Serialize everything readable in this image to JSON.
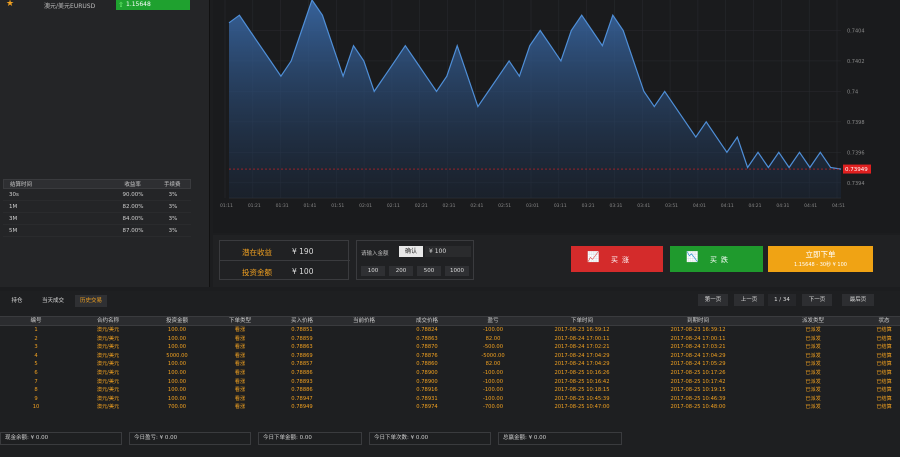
{
  "asset": {
    "name": "澳元/美元EURUSD",
    "price": "1.15648",
    "star_icon": "star-icon"
  },
  "periods": {
    "headers": [
      "结算时间",
      "收益率",
      "手续费"
    ],
    "rows": [
      [
        "30s",
        "90.00%",
        "3%"
      ],
      [
        "1M",
        "82.00%",
        "3%"
      ],
      [
        "3M",
        "84.00%",
        "3%"
      ],
      [
        "5M",
        "87.00%",
        "3%"
      ]
    ]
  },
  "chart_data": {
    "type": "area",
    "series": [
      {
        "values": [
          0.74045,
          0.7405,
          0.7404,
          0.7403,
          0.7402,
          0.7401,
          0.7402,
          0.7404,
          0.7406,
          0.7405,
          0.7403,
          0.7401,
          0.7403,
          0.7402,
          0.74,
          0.7401,
          0.7402,
          0.7403,
          0.7402,
          0.7401,
          0.74,
          0.7401,
          0.7403,
          0.7401,
          0.7399,
          0.74,
          0.7401,
          0.7402,
          0.7401,
          0.7403,
          0.7404,
          0.7403,
          0.7402,
          0.7404,
          0.7405,
          0.7404,
          0.7403,
          0.7405,
          0.7404,
          0.7402,
          0.74,
          0.7399,
          0.74,
          0.7399,
          0.7398,
          0.7397,
          0.7398,
          0.7397,
          0.7396,
          0.7397,
          0.7395,
          0.7396,
          0.7395,
          0.7396,
          0.7395,
          0.7396,
          0.7395,
          0.7396,
          0.7395,
          0.73949
        ]
      }
    ],
    "y_ticks": [
      "0.7404",
      "0.7402",
      "0.74",
      "0.7398",
      "0.7396",
      "0.7394"
    ],
    "x_ticks": [
      "01:11",
      "01:21",
      "01:31",
      "01:41",
      "01:51",
      "02:01",
      "02:11",
      "02:21",
      "02:31",
      "02:41",
      "02:51",
      "03:01",
      "03:11",
      "03:21",
      "03:31",
      "03:41",
      "03:51",
      "04:01",
      "04:11",
      "04:21",
      "04:31",
      "04:41",
      "04:51"
    ],
    "current_price_label": "0.73949",
    "ylim": [
      0.7393,
      0.7406
    ],
    "line_color": "#4f8fd8",
    "price_line_color": "#e02020"
  },
  "order": {
    "potential_label": "潜在收益",
    "potential_value": "¥ 190",
    "invest_label": "投资金额",
    "invest_value": "¥ 100",
    "amount_label": "请输入金额",
    "confirm_label": "确认",
    "amount_value": "¥ 100",
    "quick_amounts": [
      "100",
      "200",
      "500",
      "1000"
    ],
    "buy_up_label": "买涨",
    "buy_down_label": "买跌",
    "buy_up_icon": "chart-up-icon",
    "buy_down_icon": "chart-down-icon",
    "now_label": "立即下单",
    "now_sub": "1.15648 - 30秒 ¥ 100"
  },
  "tabs": [
    "持仓",
    "当天成交",
    "历史交易"
  ],
  "pager": {
    "first": "第一页",
    "prev": "上一页",
    "page": "1 / 34",
    "next": "下一页",
    "last": "最后页"
  },
  "orders": {
    "headers": [
      "编号",
      "合约名称",
      "投资金额",
      "下单类型",
      "买入价格",
      "当前价格",
      "成交价格",
      "盈亏",
      "下单时间",
      "到期时间",
      "派发类型",
      "状态"
    ],
    "rows": [
      [
        "1",
        "澳元/美元",
        "100.00",
        "看涨",
        "0.78851",
        "",
        "0.78824",
        "-100.00",
        "2017-08-23 16:39:12",
        "2017-08-23 16:39:12",
        "已派发",
        "已结算"
      ],
      [
        "2",
        "澳元/美元",
        "100.00",
        "看涨",
        "0.78859",
        "",
        "0.78863",
        "82.00",
        "2017-08-24 17:00:11",
        "2017-08-24 17:00:11",
        "已派发",
        "已结算"
      ],
      [
        "3",
        "澳元/美元",
        "100.00",
        "看涨",
        "0.78863",
        "",
        "0.78870",
        "-500.00",
        "2017-08-24 17:02:21",
        "2017-08-24 17:03:21",
        "已派发",
        "已结算"
      ],
      [
        "4",
        "澳元/美元",
        "5000.00",
        "看涨",
        "0.78869",
        "",
        "0.78876",
        "-5000.00",
        "2017-08-24 17:04:29",
        "2017-08-24 17:04:29",
        "已派发",
        "已结算"
      ],
      [
        "5",
        "澳元/美元",
        "100.00",
        "看涨",
        "0.78857",
        "",
        "0.78860",
        "82.00",
        "2017-08-24 17:04:29",
        "2017-08-24 17:05:29",
        "已派发",
        "已结算"
      ],
      [
        "6",
        "澳元/美元",
        "100.00",
        "看涨",
        "0.78886",
        "",
        "0.78900",
        "-100.00",
        "2017-08-25 10:16:26",
        "2017-08-25 10:17:26",
        "已派发",
        "已结算"
      ],
      [
        "7",
        "澳元/美元",
        "100.00",
        "看涨",
        "0.78893",
        "",
        "0.78900",
        "-100.00",
        "2017-08-25 10:16:42",
        "2017-08-25 10:17:42",
        "已派发",
        "已结算"
      ],
      [
        "8",
        "澳元/美元",
        "100.00",
        "看涨",
        "0.78886",
        "",
        "0.78916",
        "-100.00",
        "2017-08-25 10:18:15",
        "2017-08-25 10:19:15",
        "已派发",
        "已结算"
      ],
      [
        "9",
        "澳元/美元",
        "100.00",
        "看涨",
        "0.78947",
        "",
        "0.78931",
        "-100.00",
        "2017-08-25 10:45:39",
        "2017-08-25 10:46:39",
        "已派发",
        "已结算"
      ],
      [
        "10",
        "澳元/美元",
        "700.00",
        "看涨",
        "0.78949",
        "",
        "0.78974",
        "-700.00",
        "2017-08-25 10:47:00",
        "2017-08-25 10:48:00",
        "已派发",
        "已结算"
      ]
    ]
  },
  "footer": [
    "现金余额: ¥ 0.00",
    "今日盈亏: ¥ 0.00",
    "今日下单金额: 0.00",
    "今日下单次数: ¥ 0.00",
    "总赢金额: ¥ 0.00"
  ]
}
